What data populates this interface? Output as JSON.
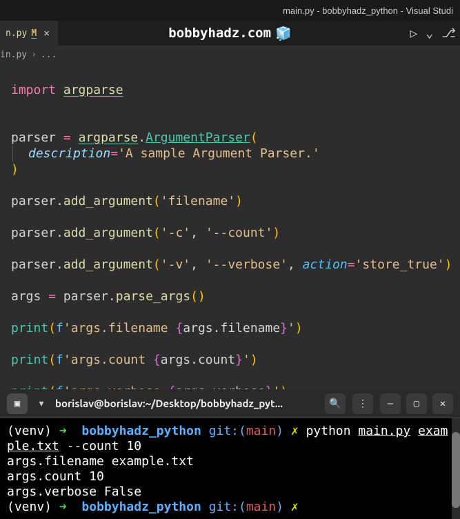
{
  "titlebar": "main.py - bobbyhadz_python - Visual Studi",
  "tab": {
    "name": "n.py",
    "mod": "M"
  },
  "site": "bobbyhadz.com",
  "breadcrumb": {
    "file": "in.py",
    "more": "..."
  },
  "code": {
    "import": "import",
    "argparse": "argparse",
    "parser": "parser",
    "eq": "=",
    "dot": ".",
    "ArgumentParser": "ArgumentParser",
    "desc": "description",
    "descval": "'A sample Argument Parser.'",
    "add_argument": "add_argument",
    "filename": "'filename'",
    "c": "'-c'",
    "count": "'--count'",
    "v": "'-v'",
    "verbose": "'--verbose'",
    "action": "action",
    "store_true": "'store_true'",
    "args": "args",
    "parse_args": "parse_args",
    "print": "print",
    "f": "f",
    "s1a": "'args.filename ",
    "s1b": "args.filename",
    "s1c": "'",
    "s2a": "'args.count ",
    "s2b": "args.count",
    "s2c": "'",
    "s3a": "'args.verbose ",
    "s3b": "args.verbose",
    "s3c": "'",
    "comma": ", "
  },
  "terminal": {
    "title": "borislav@borislav:~/Desktop/bobbyhadz_pyt...",
    "venv": "(venv)",
    "arrow": "➜",
    "dir": "bobbyhadz_python",
    "git": "git:(",
    "branch": "main",
    "gitc": ")",
    "x": "✗",
    "cmd1": "python ",
    "file": "main.py",
    "arg1": "example.txt",
    "arg2": " --count 10",
    "out1": "args.filename example.txt",
    "out2": "args.count 10",
    "out3": "args.verbose False"
  }
}
